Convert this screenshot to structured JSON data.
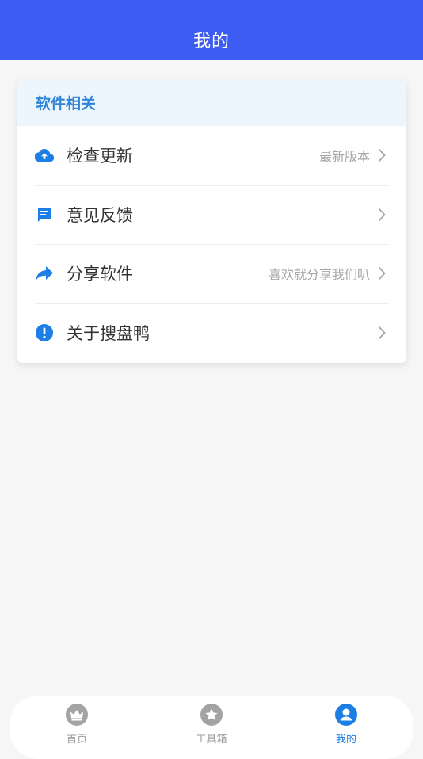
{
  "header": {
    "title": "我的"
  },
  "section": {
    "title": "软件相关",
    "items": [
      {
        "label": "检查更新",
        "value": "最新版本",
        "icon": "cloud-upload-icon"
      },
      {
        "label": "意见反馈",
        "value": "",
        "icon": "feedback-icon"
      },
      {
        "label": "分享软件",
        "value": "喜欢就分享我们叭",
        "icon": "share-icon"
      },
      {
        "label": "关于搜盘鸭",
        "value": "",
        "icon": "info-icon"
      }
    ]
  },
  "tabbar": {
    "tabs": [
      {
        "label": "首页",
        "icon": "crown-icon",
        "active": false
      },
      {
        "label": "工具箱",
        "icon": "star-icon",
        "active": false
      },
      {
        "label": "我的",
        "icon": "user-icon",
        "active": true
      }
    ]
  },
  "colors": {
    "header": "#3d5cf2",
    "accent": "#1d7fe6",
    "section_title": "#2f86d8"
  }
}
